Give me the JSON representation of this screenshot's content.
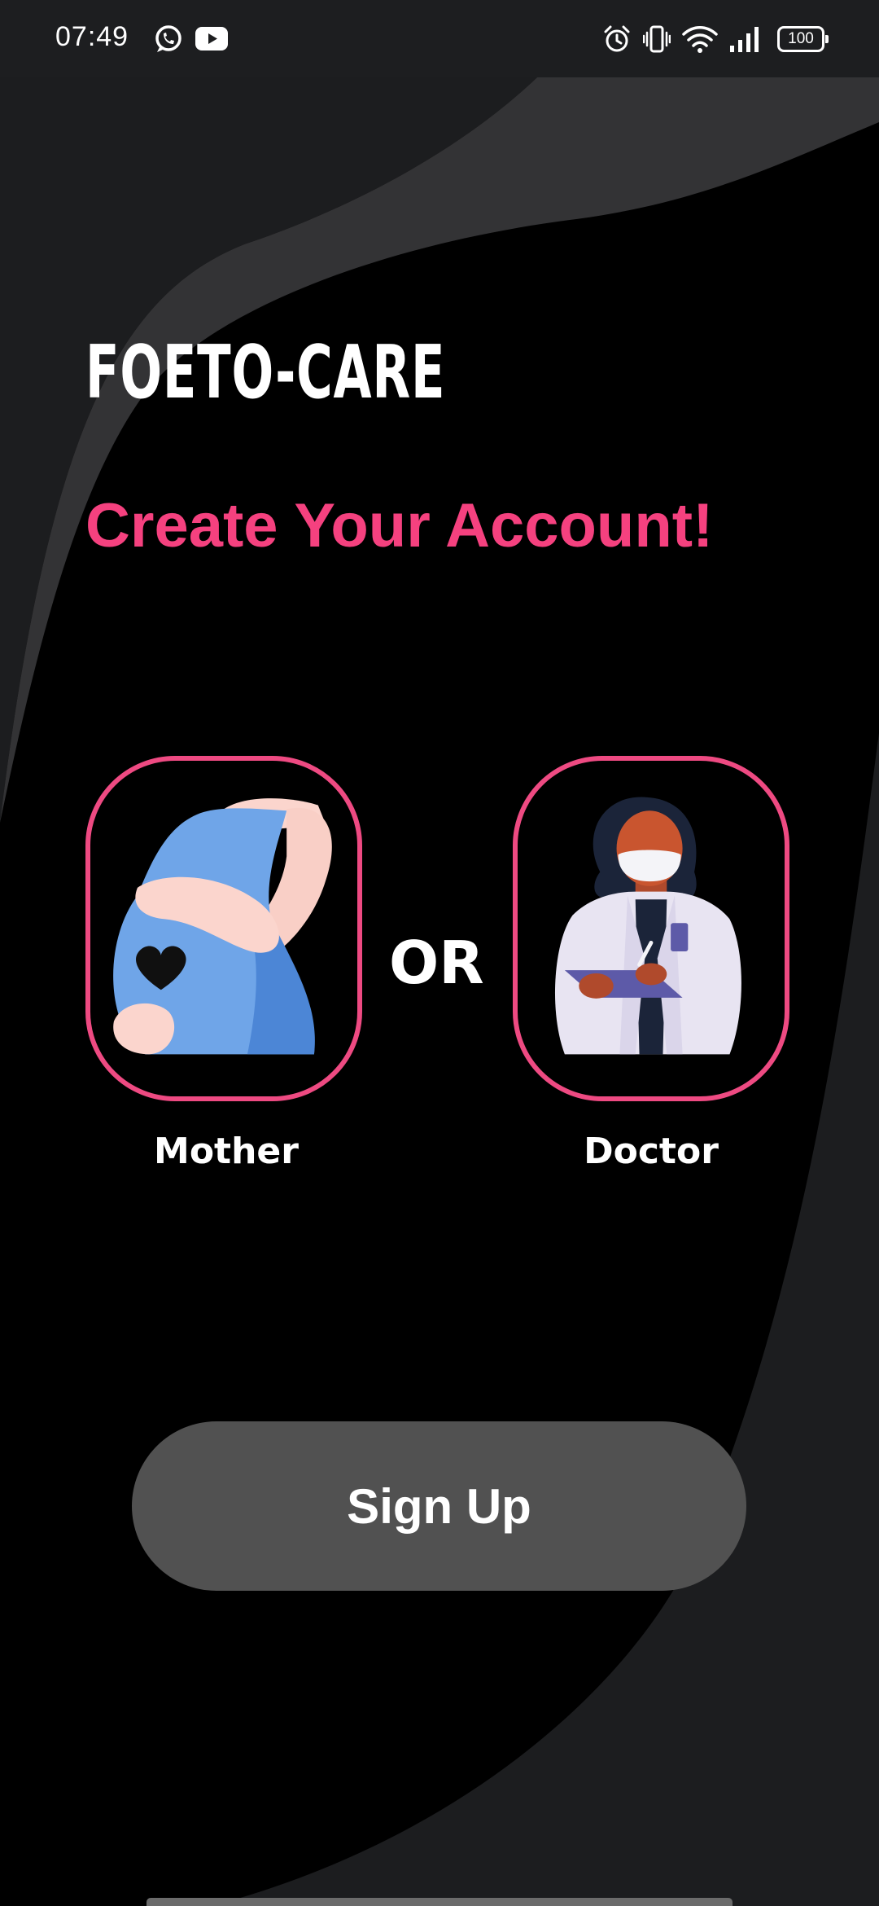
{
  "status_bar": {
    "time": "07:49",
    "battery": "100",
    "icons": [
      "whatsapp-icon",
      "youtube-icon",
      "alarm-icon",
      "vibrate-icon",
      "wifi-icon",
      "signal-icon",
      "battery-icon"
    ]
  },
  "app": {
    "title": "FOETO-CARE",
    "subtitle": "Create Your Account!"
  },
  "roles": {
    "mother_label": "Mother",
    "separator": "OR",
    "doctor_label": "Doctor"
  },
  "actions": {
    "signup_label": "Sign Up"
  },
  "colors": {
    "accent": "#ee4a82",
    "subtitle": "#f5417f",
    "button": "#515151",
    "background": "#000000",
    "wave": "#2a2b2d"
  }
}
